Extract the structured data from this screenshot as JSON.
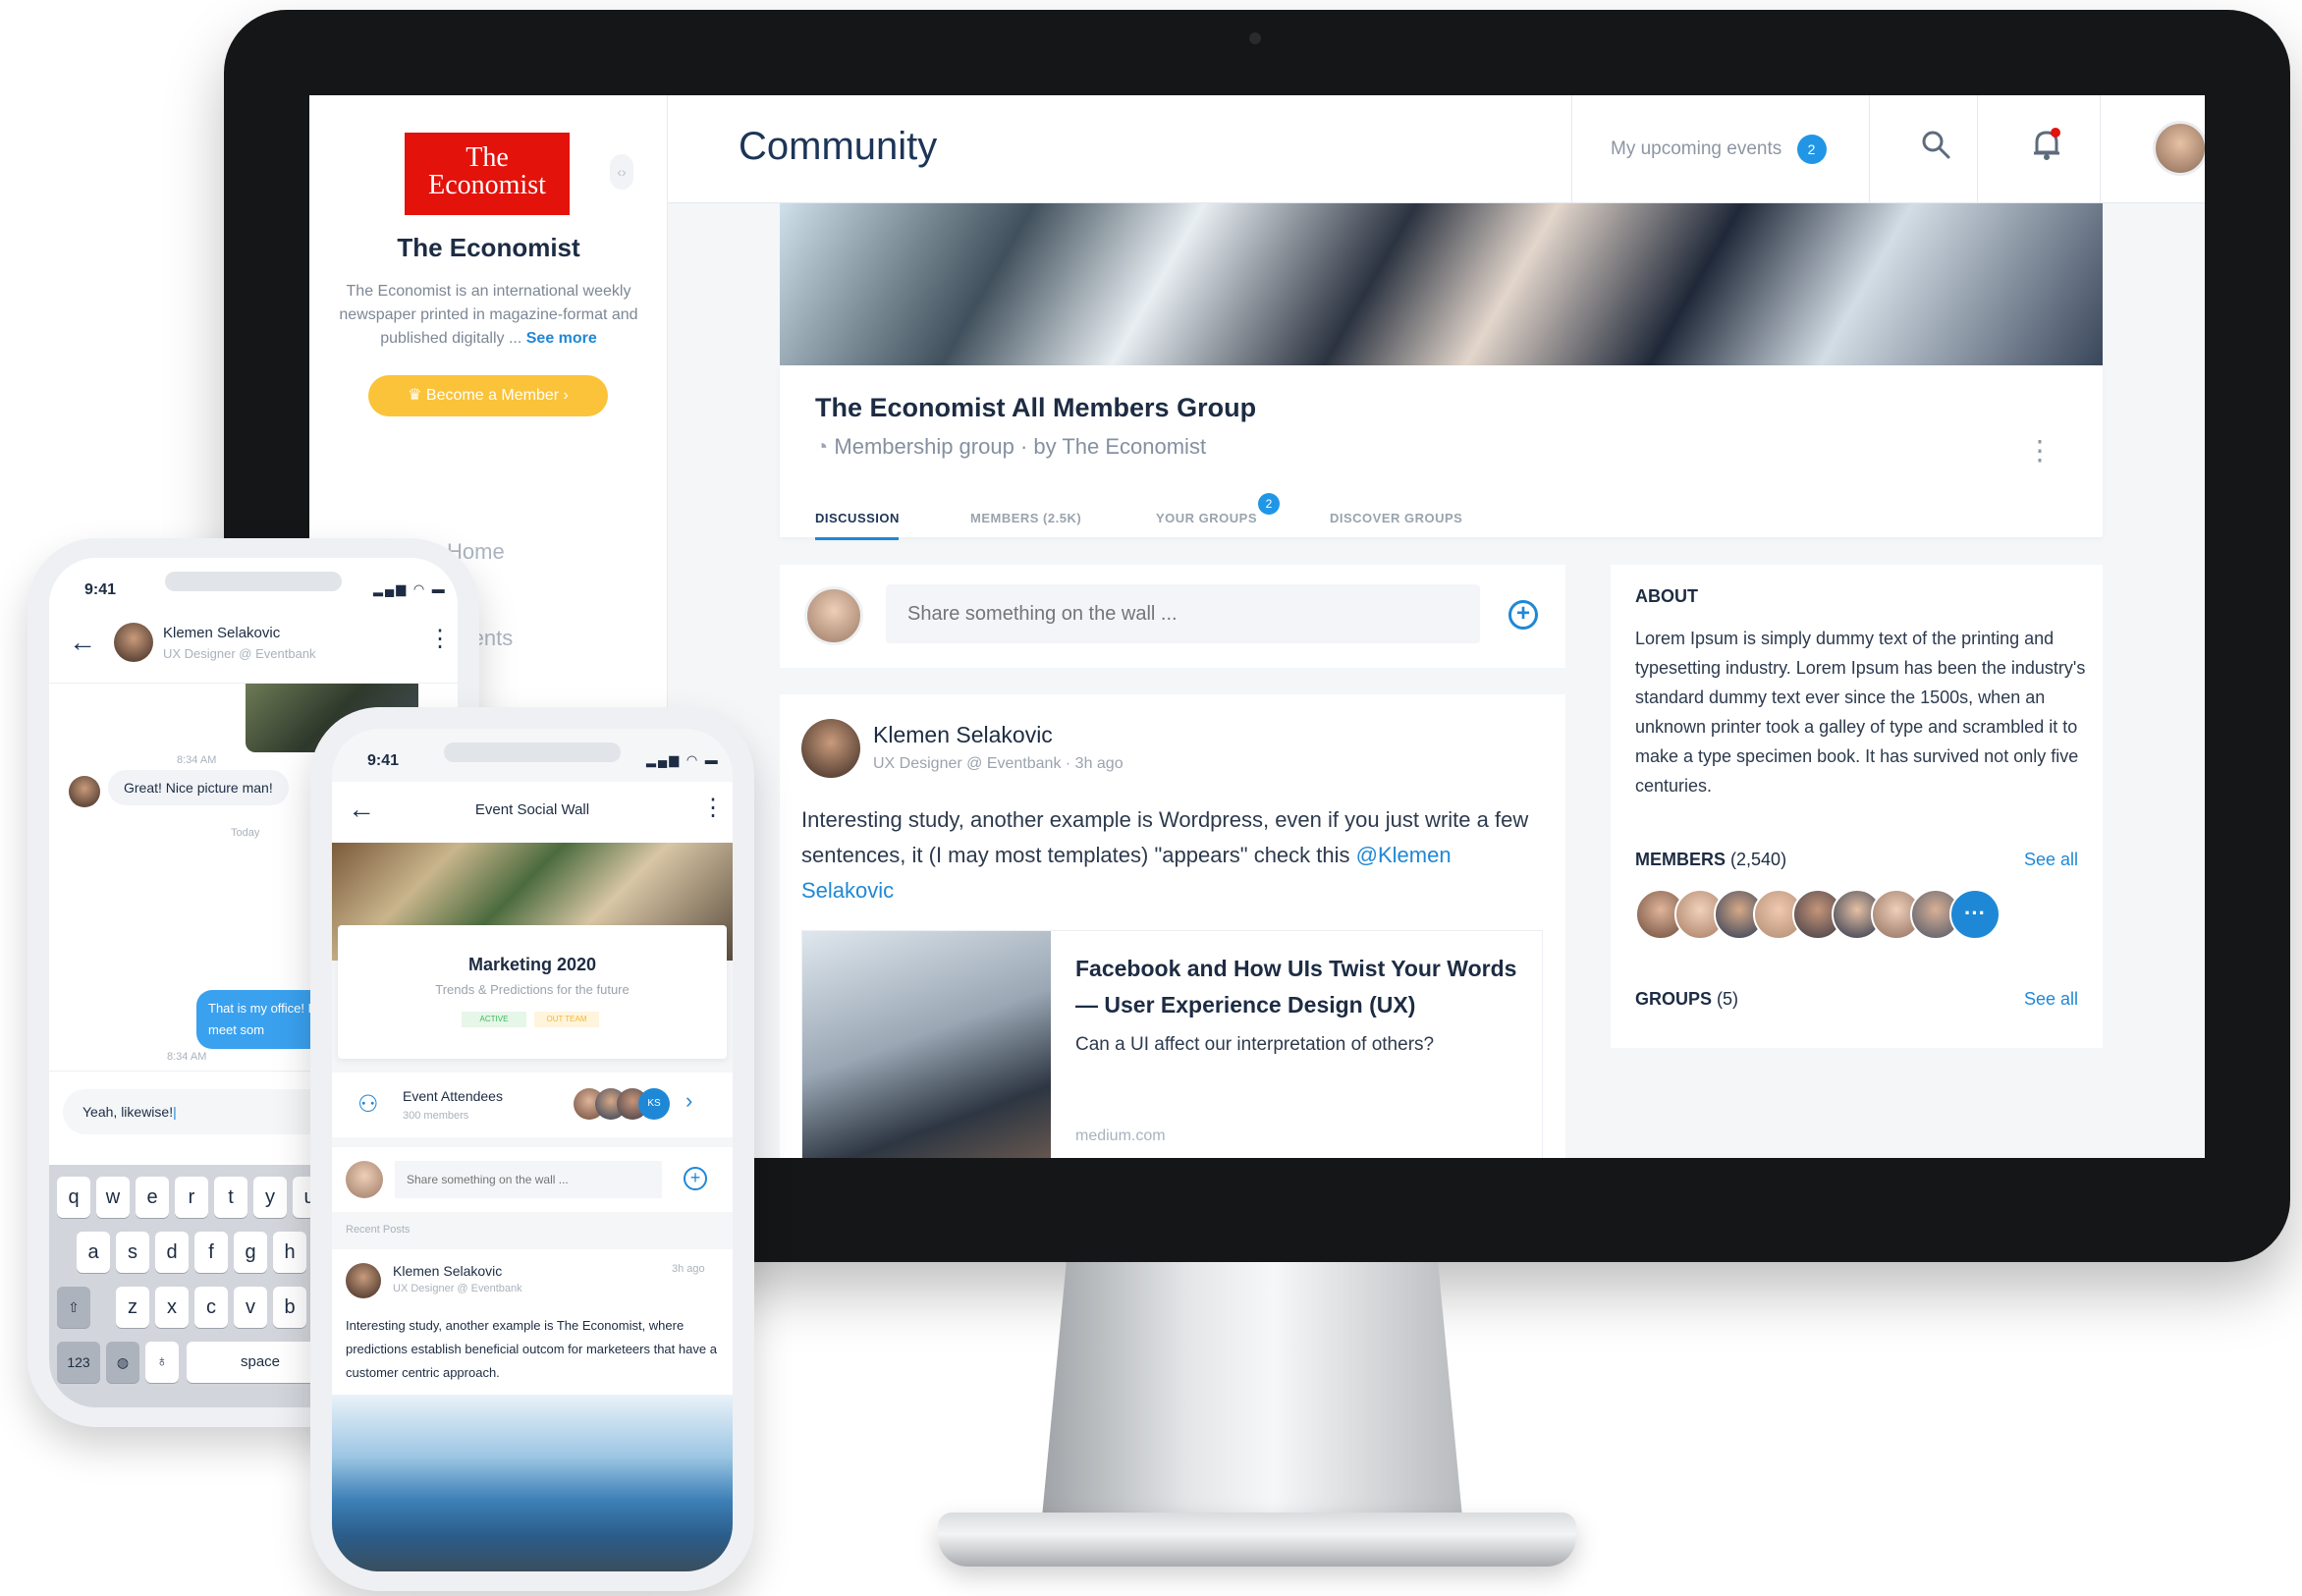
{
  "desktop": {
    "sidebar": {
      "logo_text": "The\nEconomist",
      "title": "The Economist",
      "description": "The Economist is an international weekly newspaper printed in magazine-format and published digitally ...",
      "see_more": "See more",
      "member_button": "Become a Member",
      "nav": [
        "Home",
        "Events"
      ]
    },
    "header": {
      "title": "Community",
      "upcoming_events": "My upcoming events",
      "upcoming_count": "2"
    },
    "group": {
      "name": "The Economist All Members Group",
      "subtitle": "Membership group · by The Economist",
      "tabs": [
        "DISCUSSION",
        "MEMBERS (2.5K)",
        "YOUR GROUPS",
        "DISCOVER GROUPS"
      ],
      "your_groups_badge": "2"
    },
    "share": {
      "placeholder": "Share something on the wall ..."
    },
    "post": {
      "author": "Klemen Selakovic",
      "meta": "UX Designer @ Eventbank · 3h ago",
      "body_prefix": "Interesting study, another example is Wordpress, even if you just write a few sentences, it (I may most templates) \"appears\" check this ",
      "mention": "@Klemen Selakovic",
      "link": {
        "title": "Facebook and How UIs Twist Your Words — User Experience Design (UX)",
        "description": "Can a UI affect our interpretation of others?",
        "source": "medium.com"
      }
    },
    "about": {
      "heading": "ABOUT",
      "text": "Lorem Ipsum is simply dummy text of the printing and typesetting industry. Lorem Ipsum has been the industry's standard dummy text ever since the 1500s, when an unknown printer took a galley of type and scrambled it to make a type specimen book. It has survived not only five centuries.",
      "members_label": "MEMBERS",
      "members_count": "(2,540)",
      "groups_label": "GROUPS",
      "groups_count": "(5)",
      "see_all": "See all",
      "more": "···"
    }
  },
  "phone_chat": {
    "time": "9:41",
    "contact_name": "Klemen Selakovic",
    "contact_role": "UX Designer @ Eventbank",
    "ts1": "8:34 AM",
    "msg_in": "Great! Nice picture man!",
    "day": "Today",
    "msg_out": "That is my office! Pr days, let's meet som",
    "ts2": "8:34 AM",
    "input_value": "Yeah, likewise!",
    "keys_row1": [
      "q",
      "w",
      "e",
      "r",
      "t",
      "y",
      "u"
    ],
    "keys_row2": [
      "a",
      "s",
      "d",
      "f",
      "g",
      "h"
    ],
    "keys_row3": [
      "z",
      "x",
      "c",
      "v",
      "b"
    ],
    "key_123": "123",
    "key_space": "space"
  },
  "phone_event": {
    "time": "9:41",
    "title": "Event Social Wall",
    "event_name": "Marketing 2020",
    "event_sub": "Trends & Predictions for the future",
    "tag_active": "ACTIVE",
    "tag_other": "OUT TEAM",
    "attendees_label": "Event Attendees",
    "attendees_count": "300 members",
    "attendee_initials": "KS",
    "share_placeholder": "Share something on the wall ...",
    "recent_posts": "Recent Posts",
    "post_author": "Klemen Selakovic",
    "post_role": "UX Designer @ Eventbank",
    "post_time": "3h ago",
    "post_body": "Interesting study, another example is The Economist, where predictions establish beneficial outcom for marketeers that have a customer centric approach."
  },
  "colors": {
    "accent": "#1f88d6",
    "brand_red": "#e3120b",
    "member_yellow": "#fbc33a",
    "title_navy": "#1d3557"
  }
}
